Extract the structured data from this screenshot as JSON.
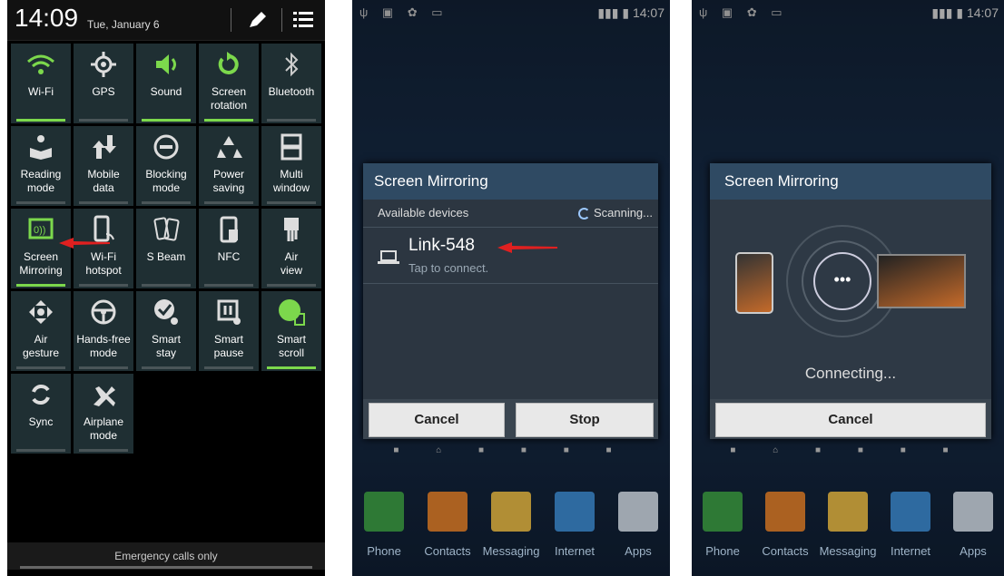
{
  "quick_settings": {
    "time": "14:09",
    "date": "Tue, January 6",
    "tiles": [
      {
        "label": "Wi-Fi",
        "icon": "wifi-icon",
        "on": true
      },
      {
        "label": "GPS",
        "icon": "gps-icon",
        "on": false
      },
      {
        "label": "Sound",
        "icon": "sound-icon",
        "on": true
      },
      {
        "label": "Screen\nrotation",
        "icon": "rotation-icon",
        "on": true
      },
      {
        "label": "Bluetooth",
        "icon": "bluetooth-icon",
        "on": false
      },
      {
        "label": "Reading\nmode",
        "icon": "reading-icon",
        "on": false
      },
      {
        "label": "Mobile\ndata",
        "icon": "mobile-data-icon",
        "on": false
      },
      {
        "label": "Blocking\nmode",
        "icon": "blocking-icon",
        "on": false
      },
      {
        "label": "Power\nsaving",
        "icon": "recycle-icon",
        "on": false
      },
      {
        "label": "Multi\nwindow",
        "icon": "multi-window-icon",
        "on": false
      },
      {
        "label": "Screen\nMirroring",
        "icon": "screen-mirroring-icon",
        "on": true
      },
      {
        "label": "Wi-Fi\nhotspot",
        "icon": "hotspot-icon",
        "on": false
      },
      {
        "label": "S Beam",
        "icon": "s-beam-icon",
        "on": false
      },
      {
        "label": "NFC",
        "icon": "nfc-icon",
        "on": false
      },
      {
        "label": "Air\nview",
        "icon": "air-view-icon",
        "on": false
      },
      {
        "label": "Air\ngesture",
        "icon": "air-gesture-icon",
        "on": false
      },
      {
        "label": "Hands-free\nmode",
        "icon": "steering-wheel-icon",
        "on": false
      },
      {
        "label": "Smart\nstay",
        "icon": "smart-stay-icon",
        "on": false
      },
      {
        "label": "Smart\npause",
        "icon": "smart-pause-icon",
        "on": false
      },
      {
        "label": "Smart\nscroll",
        "icon": "smart-scroll-icon",
        "on": true
      },
      {
        "label": "Sync",
        "icon": "sync-icon",
        "on": false
      },
      {
        "label": "Airplane\nmode",
        "icon": "airplane-icon",
        "on": false
      }
    ],
    "emergency_text": "Emergency calls only"
  },
  "screen_scanning": {
    "status_time": "14:07",
    "dialog_title": "Screen Mirroring",
    "available_label": "Available devices",
    "scanning_label": "Scanning...",
    "device_name": "Link-548",
    "device_hint": "Tap to connect.",
    "cancel_label": "Cancel",
    "stop_label": "Stop"
  },
  "screen_connecting": {
    "status_time": "14:07",
    "dialog_title": "Screen Mirroring",
    "connecting_label": "Connecting...",
    "cancel_label": "Cancel"
  },
  "dock": {
    "items": [
      {
        "label": "Phone",
        "icon": "phone-icon",
        "color": "#3a9a3a"
      },
      {
        "label": "Contacts",
        "icon": "contacts-icon",
        "color": "#e07a1f"
      },
      {
        "label": "Messaging",
        "icon": "messaging-icon",
        "color": "#e8b53a"
      },
      {
        "label": "Internet",
        "icon": "globe-icon",
        "color": "#3a86c8"
      },
      {
        "label": "Apps",
        "icon": "apps-grid-icon",
        "color": "#cfd6dc"
      }
    ]
  },
  "colors": {
    "accent_green": "#7cd84c",
    "tile_bg": "#1f2f33",
    "dialog_title_bg": "#2f4a63",
    "annotation_arrow": "#e02020"
  }
}
